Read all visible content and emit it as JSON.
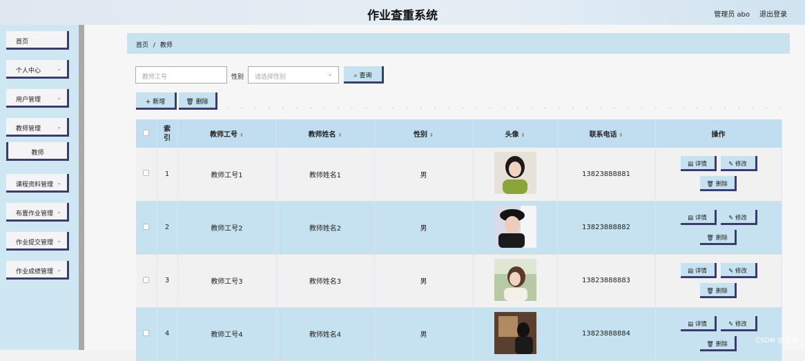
{
  "header": {
    "title": "作业查重系统",
    "user": "管理员 abo",
    "logout": "退出登录"
  },
  "sidebar": {
    "items": [
      {
        "label": "首页",
        "has_arrow": false
      },
      {
        "label": "个人中心",
        "has_arrow": true
      },
      {
        "label": "用户管理",
        "has_arrow": true
      },
      {
        "label": "教师管理",
        "has_arrow": true
      },
      {
        "label": "教师",
        "sub": true
      },
      {
        "label": "课程资料管理",
        "has_arrow": true
      },
      {
        "label": "布置作业管理",
        "has_arrow": true
      },
      {
        "label": "作业提交管理",
        "has_arrow": true
      },
      {
        "label": "作业成绩管理",
        "has_arrow": true
      }
    ]
  },
  "breadcrumb": {
    "home": "首页",
    "sep": "/",
    "current": "教师"
  },
  "search": {
    "id_placeholder": "教师工号",
    "gender_label": "性别",
    "gender_placeholder": "请选择性别",
    "query_label": "查询"
  },
  "actions": {
    "add_label": "新增",
    "delete_label": "删除"
  },
  "table": {
    "headers": {
      "index": "索引",
      "id": "教师工号",
      "name": "教师姓名",
      "gender": "性别",
      "avatar": "头像",
      "phone": "联系电话",
      "ops": "操作"
    },
    "op_labels": {
      "detail": "详情",
      "edit": "修改",
      "delete": "删除"
    },
    "rows": [
      {
        "index": "1",
        "id": "教师工号1",
        "name": "教师姓名1",
        "gender": "男",
        "phone": "13823888881"
      },
      {
        "index": "2",
        "id": "教师工号2",
        "name": "教师姓名2",
        "gender": "男",
        "phone": "13823888882"
      },
      {
        "index": "3",
        "id": "教师工号3",
        "name": "教师姓名3",
        "gender": "男",
        "phone": "13823888883"
      },
      {
        "index": "4",
        "id": "教师工号4",
        "name": "教师姓名4",
        "gender": "男",
        "phone": "13823888884"
      }
    ]
  },
  "watermark": "CSDN @佳倫",
  "colors": {
    "accent_border": "#3b3b6e",
    "header_blue": "#c1def0",
    "row_blue": "#c6e1f0"
  }
}
